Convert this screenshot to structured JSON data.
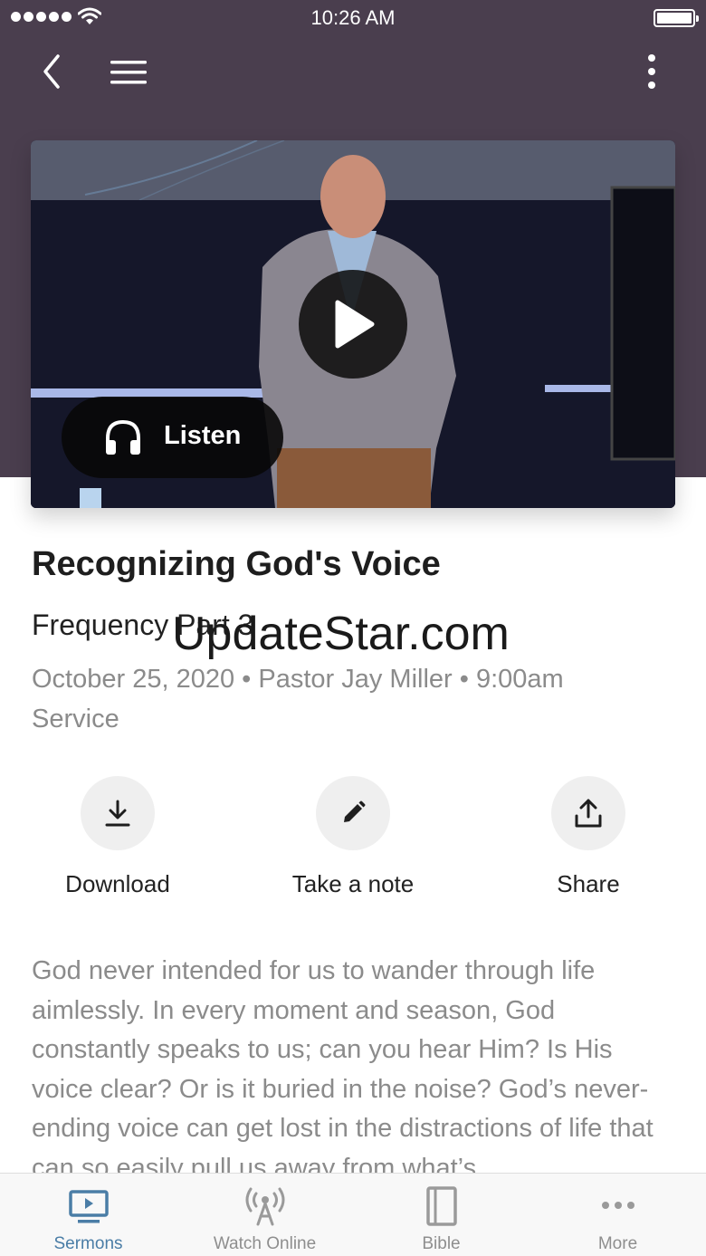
{
  "status_bar": {
    "time": "10:26 AM",
    "signal_bars": 5
  },
  "top_nav": {
    "back_icon": "chevron-left-icon",
    "menu_icon": "hamburger-icon",
    "more_icon": "vertical-ellipsis-icon"
  },
  "video": {
    "play_icon": "play-icon",
    "listen_label": "Listen",
    "listen_icon": "headphones-icon"
  },
  "sermon": {
    "title": "Recognizing God's Voice",
    "series": "Frequency Part 3",
    "meta": "October 25, 2020 • Pastor Jay Miller • 9:00am Service"
  },
  "watermark": "UpdateStar.com",
  "actions": [
    {
      "label": "Download",
      "icon": "download-icon"
    },
    {
      "label": "Take a note",
      "icon": "pencil-icon"
    },
    {
      "label": "Share",
      "icon": "share-icon"
    }
  ],
  "description": "God never intended for us to wander through life aimlessly. In every moment and season, God constantly speaks to us; can you hear Him? Is His voice clear? Or is it buried in the noise? God’s never-ending voice can get lost in the distractions of life that can so easily pull us away from what’s",
  "tabs": [
    {
      "label": "Sermons",
      "icon": "monitor-play-icon",
      "active": true
    },
    {
      "label": "Watch Online",
      "icon": "broadcast-tower-icon",
      "active": false
    },
    {
      "label": "Bible",
      "icon": "book-icon",
      "active": false
    },
    {
      "label": "More",
      "icon": "horizontal-ellipsis-icon",
      "active": false
    }
  ],
  "colors": {
    "header_bg": "#4a3e4e",
    "active_tab": "#4a7da6",
    "inactive_tab": "#8e8e8e",
    "meta_text": "#8b8b8b"
  }
}
